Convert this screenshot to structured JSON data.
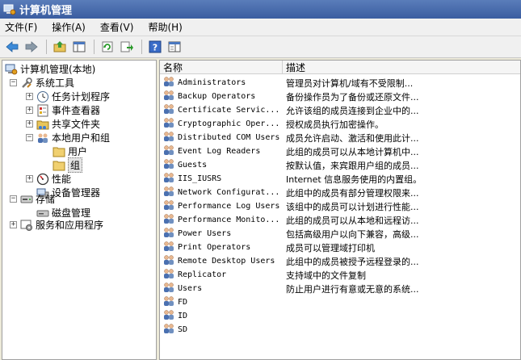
{
  "window": {
    "title": "计算机管理"
  },
  "menu": [
    "文件(F)",
    "操作(A)",
    "查看(V)",
    "帮助(H)"
  ],
  "toolbar": {
    "buttons": [
      "back-icon",
      "forward-icon",
      "up-folder-icon",
      "show-hide-tree-icon",
      "refresh-icon",
      "export-list-icon",
      "help-icon",
      "properties-icon"
    ]
  },
  "tree": {
    "root": "计算机管理(本地)",
    "system_tools": "系统工具",
    "task_scheduler": "任务计划程序",
    "event_viewer": "事件查看器",
    "shared_folders": "共享文件夹",
    "local_users_groups": "本地用户和组",
    "users": "用户",
    "groups": "组",
    "performance": "性能",
    "device_manager": "设备管理器",
    "storage": "存储",
    "disk_management": "磁盘管理",
    "services_apps": "服务和应用程序"
  },
  "list": {
    "columns": [
      "名称",
      "描述"
    ],
    "rows": [
      {
        "name": "Administrators",
        "desc": "管理员对计算机/域有不受限制..."
      },
      {
        "name": "Backup Operators",
        "desc": "备份操作员为了备份或还原文件..."
      },
      {
        "name": "Certificate Servic...",
        "desc": "允许该组的成员连接到企业中的..."
      },
      {
        "name": "Cryptographic Oper...",
        "desc": "授权成员执行加密操作。"
      },
      {
        "name": "Distributed COM Users",
        "desc": "成员允许启动、激活和使用此计..."
      },
      {
        "name": "Event Log Readers",
        "desc": "此组的成员可以从本地计算机中..."
      },
      {
        "name": "Guests",
        "desc": "按默认值，来宾跟用户组的成员..."
      },
      {
        "name": "IIS_IUSRS",
        "desc": "Internet 信息服务使用的内置组。"
      },
      {
        "name": "Network Configurat...",
        "desc": "此组中的成员有部分管理权限来..."
      },
      {
        "name": "Performance Log Users",
        "desc": "该组中的成员可以计划进行性能..."
      },
      {
        "name": "Performance Monito...",
        "desc": "此组的成员可以从本地和远程访..."
      },
      {
        "name": "Power Users",
        "desc": "包括高级用户以向下兼容，高级..."
      },
      {
        "name": "Print Operators",
        "desc": "成员可以管理域打印机"
      },
      {
        "name": "Remote Desktop Users",
        "desc": "此组中的成员被授予远程登录的..."
      },
      {
        "name": "Replicator",
        "desc": "支持域中的文件复制"
      },
      {
        "name": "Users",
        "desc": "防止用户进行有意或无意的系统..."
      },
      {
        "name": "FD",
        "desc": ""
      },
      {
        "name": "ID",
        "desc": ""
      },
      {
        "name": "SD",
        "desc": ""
      }
    ]
  }
}
